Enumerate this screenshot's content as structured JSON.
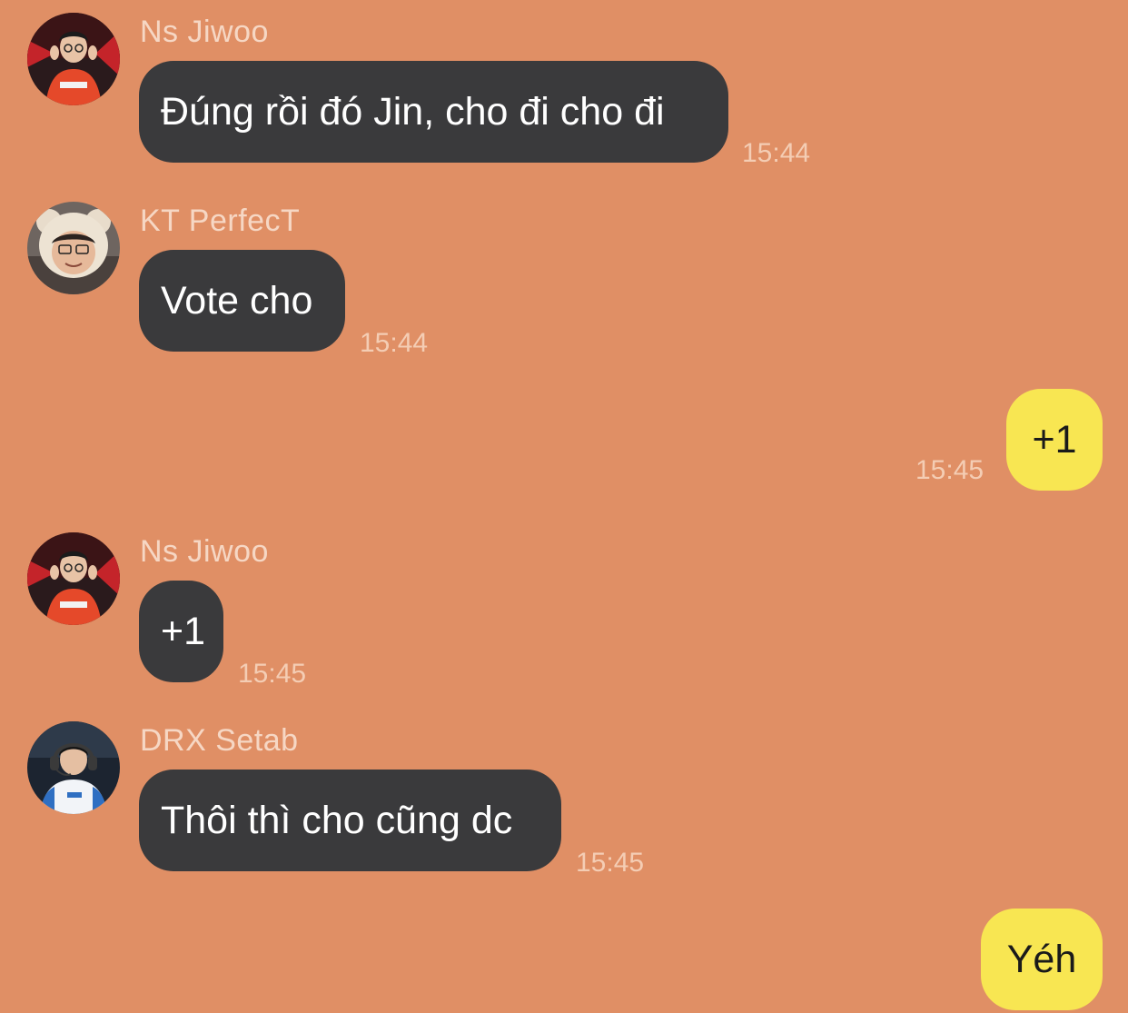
{
  "colors": {
    "background": "#E08F65",
    "incoming_bubble": "#3A3A3C",
    "outgoing_bubble": "#F8E652",
    "sender_name": "#F6D7C4",
    "timestamp": "#F4CDB4"
  },
  "messages": [
    {
      "direction": "incoming",
      "sender": "Ns Jiwoo",
      "avatar_icon": "red-jersey-avatar",
      "text": "Đúng rồi đó Jin, cho đi cho đi",
      "time": "15:44"
    },
    {
      "direction": "incoming",
      "sender": "KT PerfecT",
      "avatar_icon": "bear-hat-avatar",
      "text": "Vote cho",
      "time": "15:44"
    },
    {
      "direction": "outgoing",
      "text": "+1",
      "time": "15:45"
    },
    {
      "direction": "incoming",
      "sender": "Ns Jiwoo",
      "avatar_icon": "red-jersey-avatar",
      "text": "+1",
      "time": "15:45"
    },
    {
      "direction": "incoming",
      "sender": "DRX Setab",
      "avatar_icon": "headset-avatar",
      "text": "Thôi thì cho cũng dc",
      "time": "15:45"
    },
    {
      "direction": "outgoing",
      "text": "Yéh",
      "time": ""
    }
  ]
}
